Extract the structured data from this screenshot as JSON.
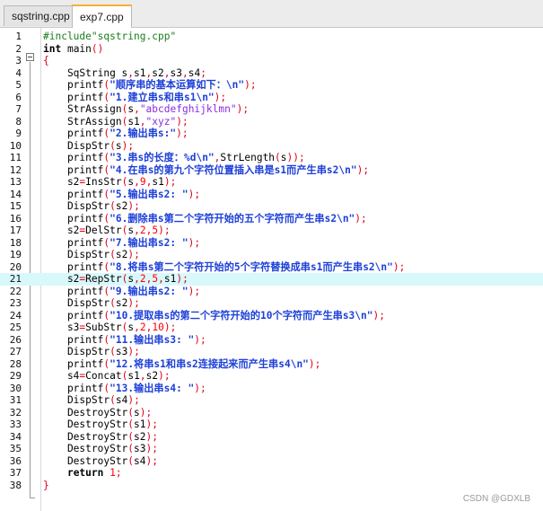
{
  "tabs": [
    {
      "label": "sqstring.cpp",
      "active": false
    },
    {
      "label": "exp7.cpp",
      "active": true
    }
  ],
  "editor": {
    "current_line": 21,
    "lines": [
      "#include\"sqstring.cpp\"",
      "int main()",
      "{",
      "    SqString s,s1,s2,s3,s4;",
      "    printf(\"顺序串的基本运算如下：\\n\");",
      "    printf(\"1.建立串s和串s1\\n\");",
      "    StrAssign(s,\"abcdefghijklmn\");",
      "    StrAssign(s1,\"xyz\");",
      "    printf(\"2.输出串s:\");",
      "    DispStr(s);",
      "    printf(\"3.串s的长度：%d\\n\",StrLength(s));",
      "    printf(\"4.在串s的第九个字符位置插入串是s1而产生串s2\\n\");",
      "    s2=InsStr(s,9,s1);",
      "    printf(\"5.输出串s2: \");",
      "    DispStr(s2);",
      "    printf(\"6.删除串s第二个字符开始的五个字符而产生串s2\\n\");",
      "    s2=DelStr(s,2,5);",
      "    printf(\"7.输出串s2: \");",
      "    DispStr(s2);",
      "    printf(\"8.将串s第二个字符开始的5个字符替换成串s1而产生串s2\\n\");",
      "    s2=RepStr(s,2,5,s1);",
      "    printf(\"9.输出串s2: \");",
      "    DispStr(s2);",
      "    printf(\"10.提取串s的第二个字符开始的10个字符而产生串s3\\n\");",
      "    s3=SubStr(s,2,10);",
      "    printf(\"11.输出串s3: \");",
      "    DispStr(s3);",
      "    printf(\"12.将串s1和串s2连接起来而产生串s4\\n\");",
      "    s4=Concat(s1,s2);",
      "    printf(\"13.输出串s4: \");",
      "    DispStr(s4);",
      "    DestroyStr(s);",
      "    DestroyStr(s1);",
      "    DestroyStr(s2);",
      "    DestroyStr(s3);",
      "    DestroyStr(s4);",
      "    return 1;",
      "}"
    ]
  },
  "watermark": "CSDN @GDXLB",
  "colors": {
    "keyword": "#000000",
    "preprocessor": "#1a7d1a",
    "string": "#1c3fd8",
    "number": "#ff0000",
    "current_line": "#d8f8fb"
  }
}
